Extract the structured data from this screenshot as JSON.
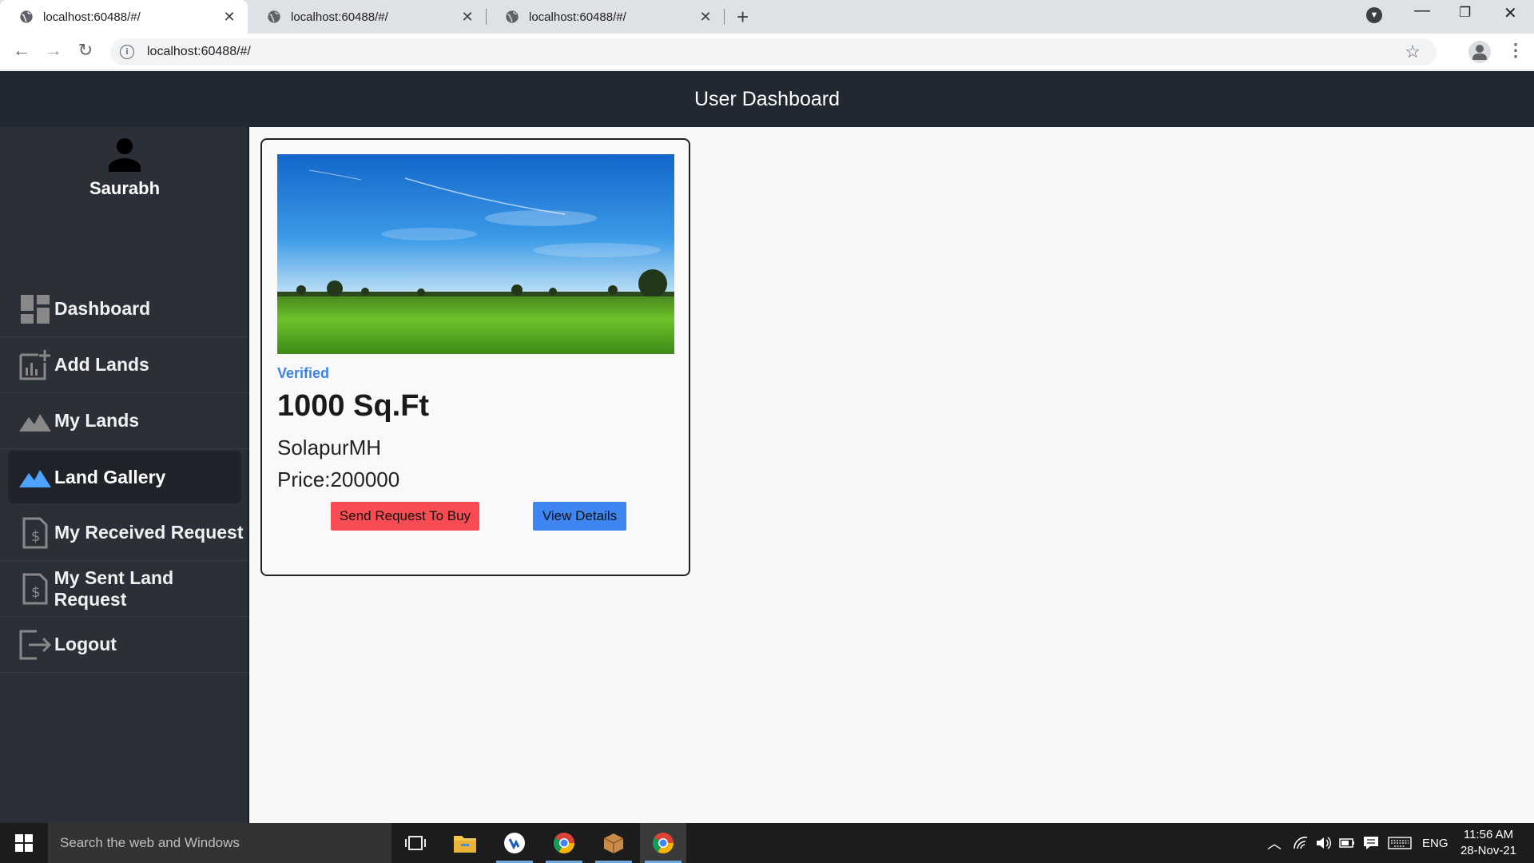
{
  "browser": {
    "tabs": [
      {
        "title": "localhost:60488/#/",
        "active": true
      },
      {
        "title": "localhost:60488/#/",
        "active": false
      },
      {
        "title": "localhost:60488/#/",
        "active": false
      }
    ],
    "url": "localhost:60488/#/"
  },
  "header": {
    "title": "User Dashboard"
  },
  "sidebar": {
    "user_name": "Saurabh",
    "items": [
      {
        "label": "Dashboard",
        "icon": "dashboard-icon",
        "active": false
      },
      {
        "label": "Add Lands",
        "icon": "add-chart-icon",
        "active": false
      },
      {
        "label": "My Lands",
        "icon": "landscape-icon",
        "active": false
      },
      {
        "label": "Land Gallery",
        "icon": "landscape-icon",
        "active": true
      },
      {
        "label": "My Received Request",
        "icon": "request-document-icon",
        "active": false
      },
      {
        "label": "My Sent Land Request",
        "icon": "request-document-icon",
        "active": false
      },
      {
        "label": "Logout",
        "icon": "logout-icon",
        "active": false
      }
    ]
  },
  "land_card": {
    "status": "Verified",
    "area": "1000 Sq.Ft",
    "location": "SolapurMH",
    "price": "Price:200000",
    "request_button": "Send Request To Buy",
    "details_button": "View Details"
  },
  "taskbar": {
    "search_placeholder": "Search the web and Windows",
    "language": "ENG",
    "time": "11:56 AM",
    "date": "28-Nov-21"
  },
  "colors": {
    "header_bg": "#222831",
    "sidebar_bg": "#2b3038",
    "accent_blue": "#3e85f2",
    "request_red": "#f64c52",
    "active_icon": "#4da3ff"
  }
}
